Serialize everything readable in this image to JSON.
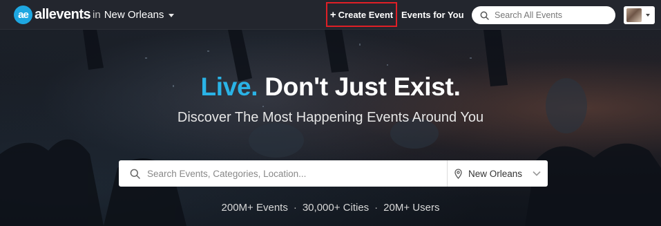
{
  "header": {
    "logo_mark": "ae",
    "logo_text": "allevents",
    "city_prefix": "in",
    "city_name": "New Orleans",
    "create_event_label": "Create Event",
    "create_event_icon": "plus-icon",
    "events_for_you_label": "Events for You",
    "search_placeholder": "Search All Events",
    "highlight_color": "#e01f26"
  },
  "hero": {
    "headline_accent": "Live.",
    "headline_rest": "Don't Just Exist.",
    "subheadline": "Discover The Most Happening Events Around You",
    "search_placeholder": "Search Events, Categories, Location...",
    "location_value": "New Orleans",
    "stats": [
      "200M+ Events",
      "30,000+ Cities",
      "20M+ Users"
    ],
    "stats_separator": "·"
  },
  "colors": {
    "brand_blue": "#2ab3e6",
    "header_bg": "#23262e"
  }
}
